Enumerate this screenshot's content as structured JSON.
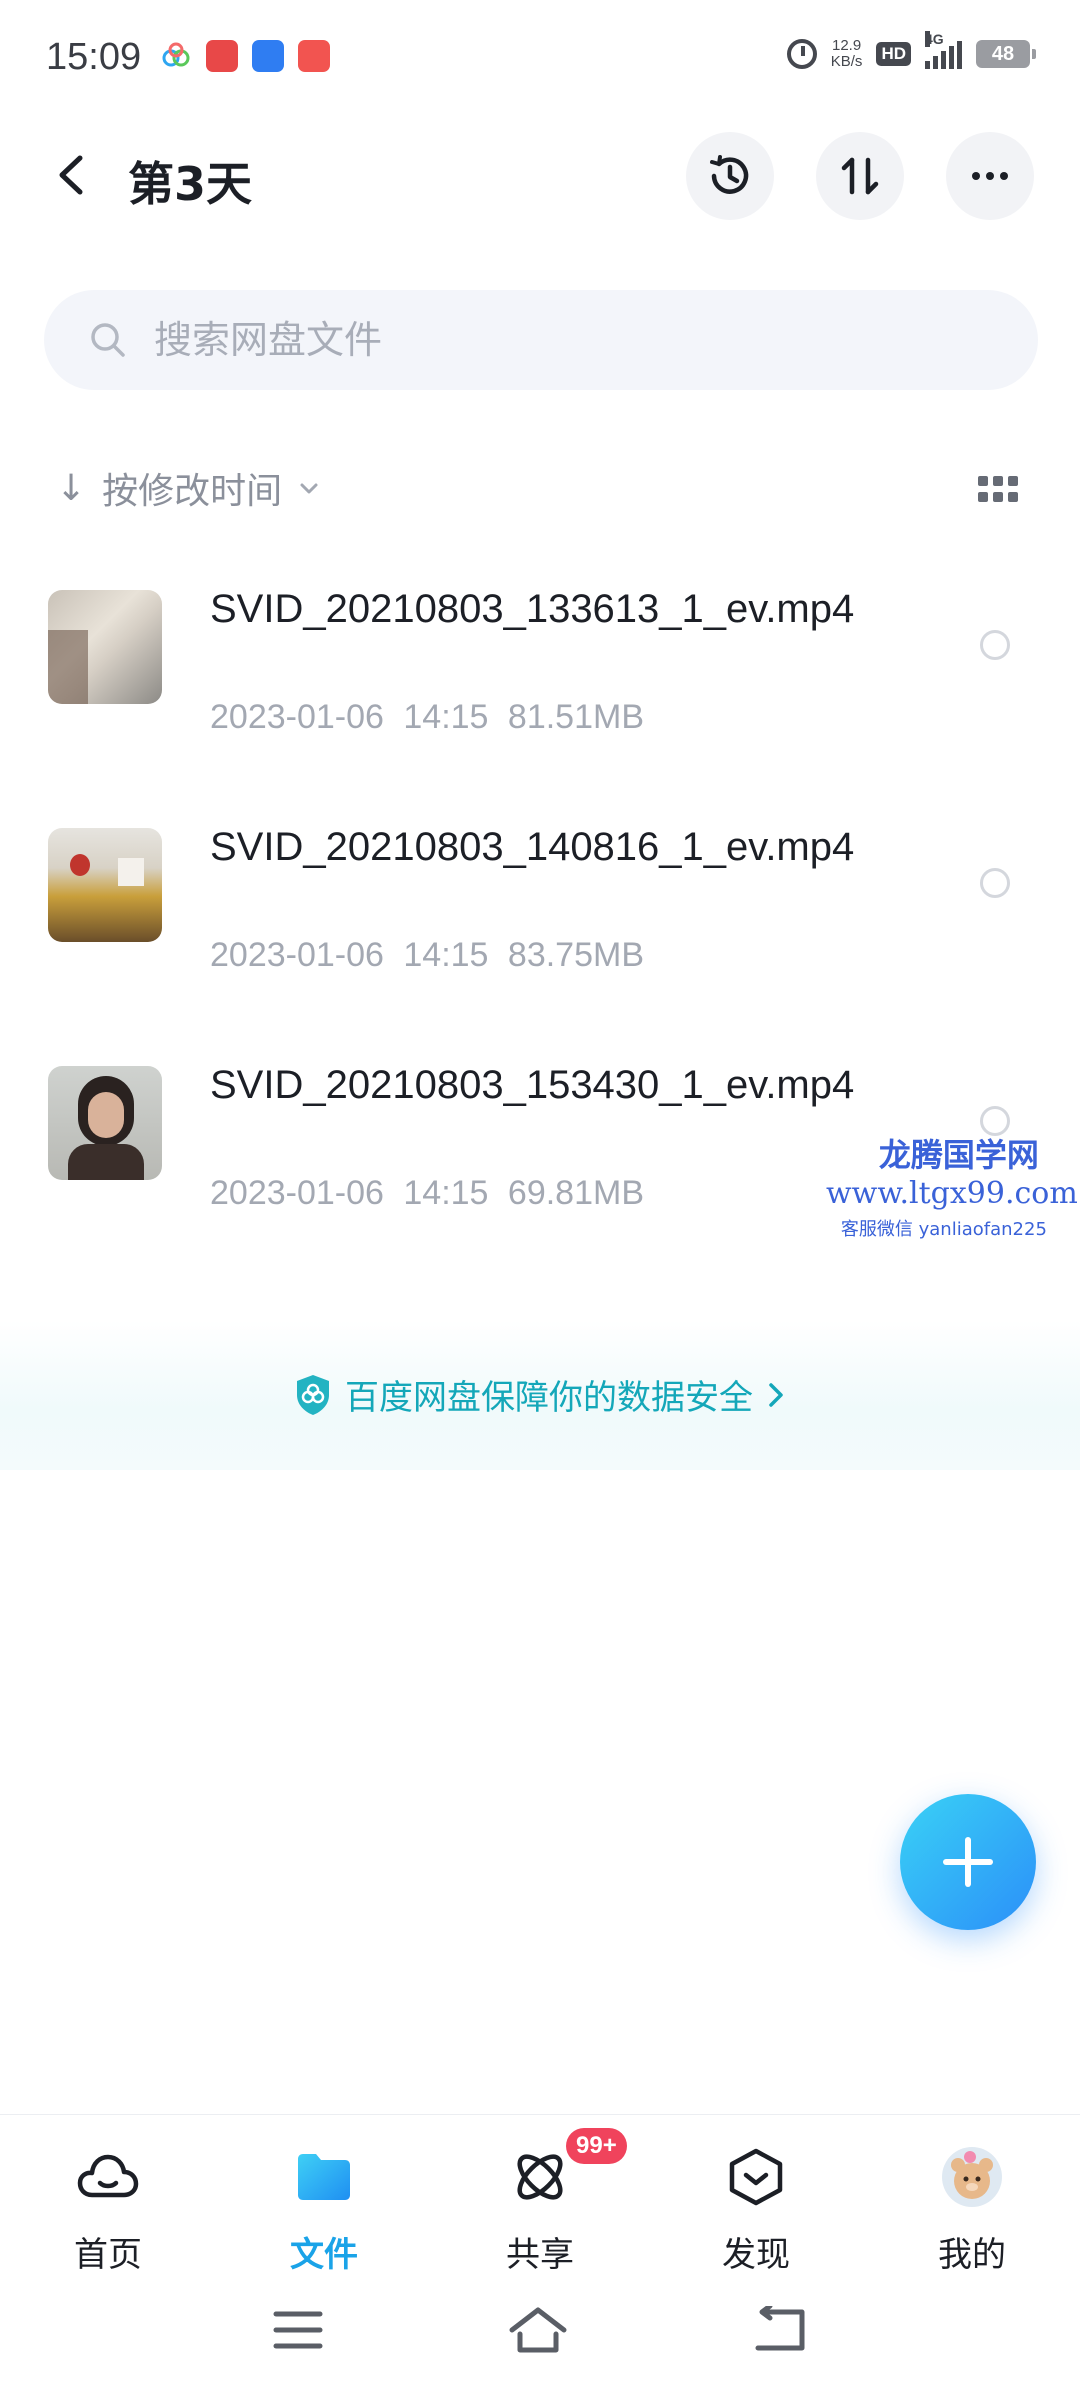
{
  "status_bar": {
    "time": "15:09",
    "speed_value": "12.9",
    "speed_unit": "KB/s",
    "hd": "HD",
    "network": "4G",
    "battery": "48"
  },
  "header": {
    "title": "第3天"
  },
  "search": {
    "placeholder": "搜索网盘文件"
  },
  "sort": {
    "label": "按修改时间"
  },
  "files": [
    {
      "name": "SVID_20210803_133613_1_ev.mp4",
      "date": "2023-01-06",
      "time": "14:15",
      "size": "81.51MB"
    },
    {
      "name": "SVID_20210803_140816_1_ev.mp4",
      "date": "2023-01-06",
      "time": "14:15",
      "size": "83.75MB"
    },
    {
      "name": "SVID_20210803_153430_1_ev.mp4",
      "date": "2023-01-06",
      "time": "14:15",
      "size": "69.81MB"
    }
  ],
  "watermark": {
    "title": "龙腾国学网",
    "url": "www.ltgx99.com",
    "contact": "客服微信 yanliaofan225"
  },
  "banner": {
    "text": "百度网盘保障你的数据安全"
  },
  "bottom_nav": {
    "items": [
      {
        "label": "首页",
        "icon": "cloud-icon"
      },
      {
        "label": "文件",
        "icon": "folder-icon"
      },
      {
        "label": "共享",
        "icon": "share-atom-icon"
      },
      {
        "label": "发现",
        "icon": "discover-box-icon"
      },
      {
        "label": "我的",
        "icon": "avatar-icon"
      }
    ],
    "badge": "99+",
    "active_index": 1
  },
  "colors": {
    "accent": "#1aa3e8",
    "banner_text": "#14a7b9",
    "badge": "#f0435c"
  }
}
